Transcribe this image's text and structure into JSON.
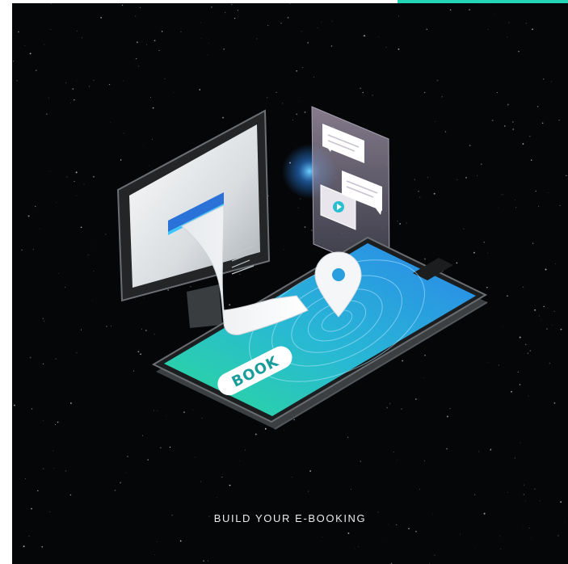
{
  "poster": {
    "caption": "BUILD YOUR E-BOOKING",
    "button_label": "BOOK"
  },
  "icons": [
    "map-pin-icon",
    "chat-bubble-icon",
    "video-play-icon",
    "receipt-icon"
  ],
  "colors": {
    "background": "#050607",
    "accent": "#22d6b5",
    "screen_top": "#2a8fe6",
    "screen_bottom": "#2bd3a6",
    "button_text": "#1a9d9a"
  }
}
